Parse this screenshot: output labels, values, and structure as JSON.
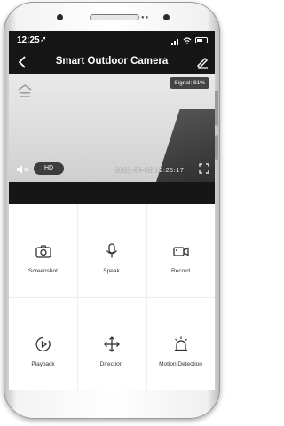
{
  "status_bar": {
    "time": "12:25"
  },
  "nav": {
    "title": "Smart Outdoor Camera"
  },
  "video": {
    "signal_text": "Signal: 81%",
    "quality_label": "HD",
    "timestamp": "2021-06-02  12:25:17"
  },
  "actions": [
    {
      "label": "Screenshot",
      "icon": "camera-icon"
    },
    {
      "label": "Speak",
      "icon": "microphone-icon"
    },
    {
      "label": "Record",
      "icon": "video-record-icon"
    },
    {
      "label": "Playback",
      "icon": "playback-icon"
    },
    {
      "label": "Direction",
      "icon": "direction-arrows-icon"
    },
    {
      "label": "Motion Detection",
      "icon": "alarm-siren-icon"
    }
  ],
  "colors": {
    "header_bg": "#161616",
    "grid_bg": "#ffffff",
    "icon": "#333333"
  }
}
